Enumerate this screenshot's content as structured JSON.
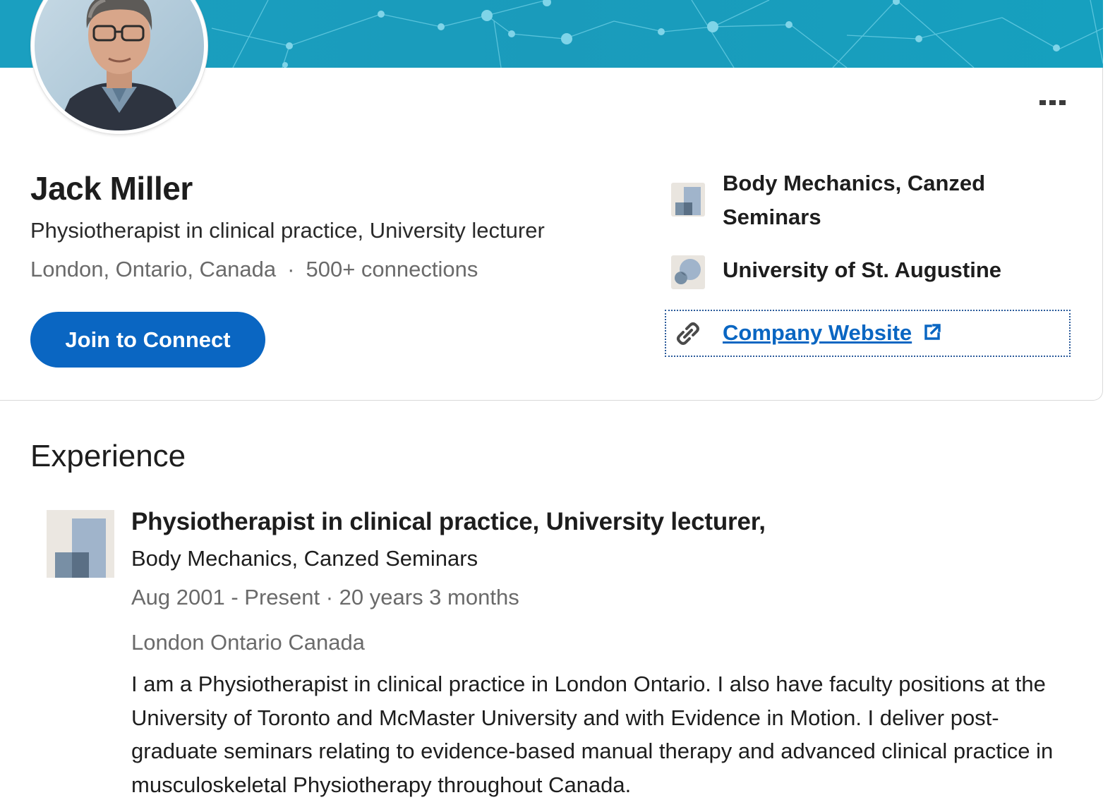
{
  "profile": {
    "name": "Jack Miller",
    "headline": "Physiotherapist in clinical practice, University lecturer",
    "location": "London, Ontario, Canada",
    "separator": "·",
    "connections": "500+ connections",
    "join_label": "Join to Connect"
  },
  "sidebar": {
    "company": "Body Mechanics, Canzed Seminars",
    "school": "University of St. Augustine",
    "website_label": "Company Website"
  },
  "experience": {
    "section_title": "Experience",
    "items": [
      {
        "title": "Physiotherapist in clinical practice, University lecturer,",
        "company": "Body Mechanics, Canzed Seminars",
        "dates": "Aug 2001 - Present · 20 years 3 months",
        "location": "London Ontario Canada",
        "description": "I am a Physiotherapist in clinical practice in London Ontario. I also have faculty positions at the University of Toronto and McMaster University and with Evidence in Motion. I deliver post-graduate seminars relating to evidence-based manual therapy and advanced clinical practice in musculoskeletal Physiotherapy throughout Canada."
      }
    ]
  },
  "icons": {
    "more": "more-dots-icon",
    "company": "company-logo-icon",
    "school": "school-logo-icon",
    "link": "link-icon",
    "external": "external-link-icon"
  },
  "colors": {
    "banner": "#1a9fc0",
    "primary": "#0a66c2",
    "secondary_text": "#6a6a6a"
  }
}
